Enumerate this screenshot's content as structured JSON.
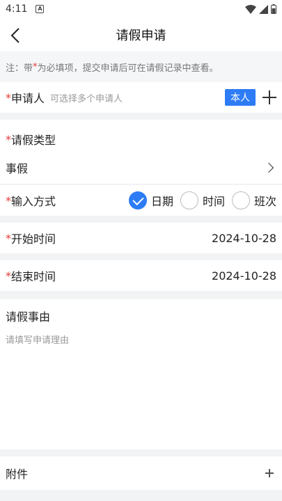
{
  "status": {
    "time": "4:11",
    "app_badge": "A"
  },
  "nav": {
    "title": "请假申请"
  },
  "notice": {
    "prefix": "注：带",
    "star": "*",
    "suffix": "为必填项，提交申请后可在请假记录中查看。"
  },
  "applicant": {
    "star": "*",
    "label": "申请人",
    "hint": "可选择多个申请人",
    "tag": "本人"
  },
  "leave_type": {
    "star": "*",
    "label": "请假类型",
    "value": "事假"
  },
  "input_mode": {
    "star": "*",
    "label": "输入方式",
    "options": [
      {
        "label": "日期",
        "checked": true
      },
      {
        "label": "时间",
        "checked": false
      },
      {
        "label": "班次",
        "checked": false
      }
    ]
  },
  "start": {
    "star": "*",
    "label": "开始时间",
    "value": "2024-10-28"
  },
  "end": {
    "star": "*",
    "label": "结束时间",
    "value": "2024-10-28"
  },
  "reason": {
    "label": "请假事由",
    "placeholder": "请填写申请理由"
  },
  "attachment": {
    "label": "附件"
  }
}
